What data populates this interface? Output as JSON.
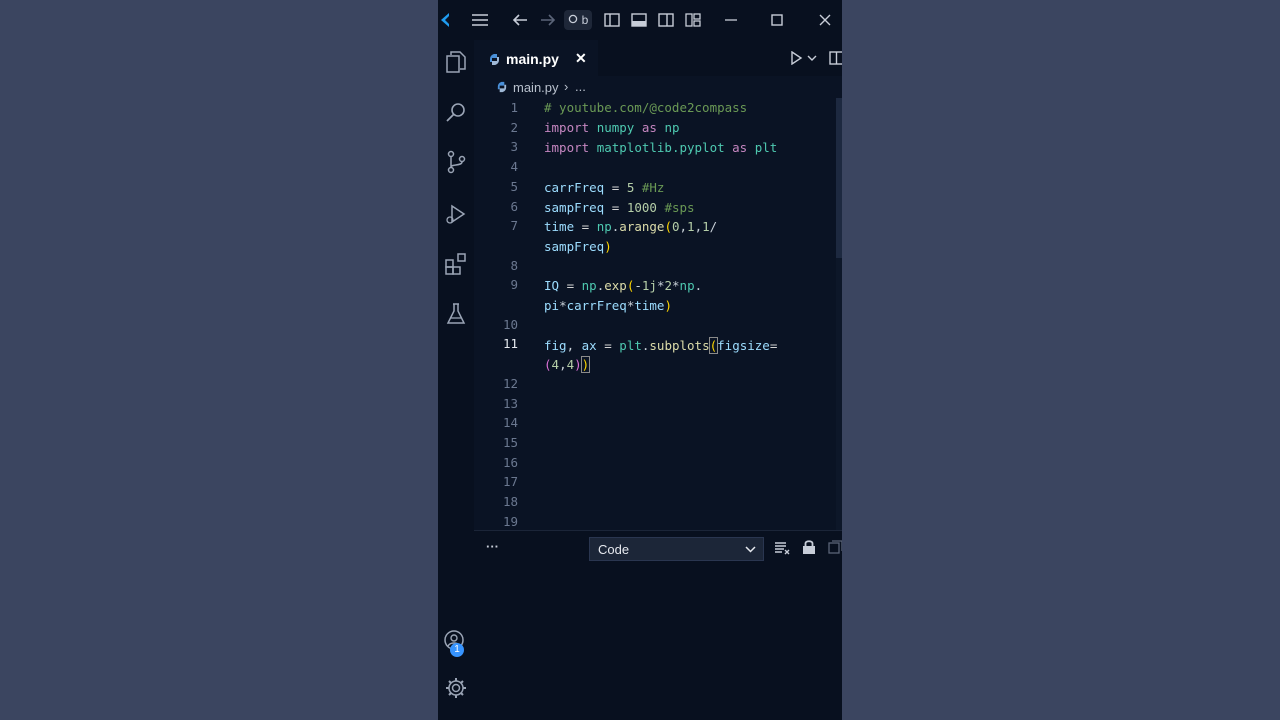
{
  "window": {
    "command_center_text": "b"
  },
  "tab": {
    "filename": "main.py",
    "close_glyph": "✕"
  },
  "breadcrumb": {
    "file": "main.py",
    "separator": "›",
    "more": "..."
  },
  "editor": {
    "line_numbers": [
      "1",
      "2",
      "3",
      "4",
      "5",
      "6",
      "7",
      "",
      "8",
      "9",
      "",
      "10",
      "11",
      "",
      "12",
      "13",
      "14",
      "15",
      "16",
      "17",
      "18",
      "19"
    ],
    "active_line": "11"
  },
  "panel": {
    "more": "···",
    "select_value": "Code"
  },
  "accounts_badge": "1",
  "colors": {
    "background": "#3b4560",
    "editor_bg": "#0a1324",
    "chrome_bg": "#08101f",
    "accent": "#3794ff"
  }
}
